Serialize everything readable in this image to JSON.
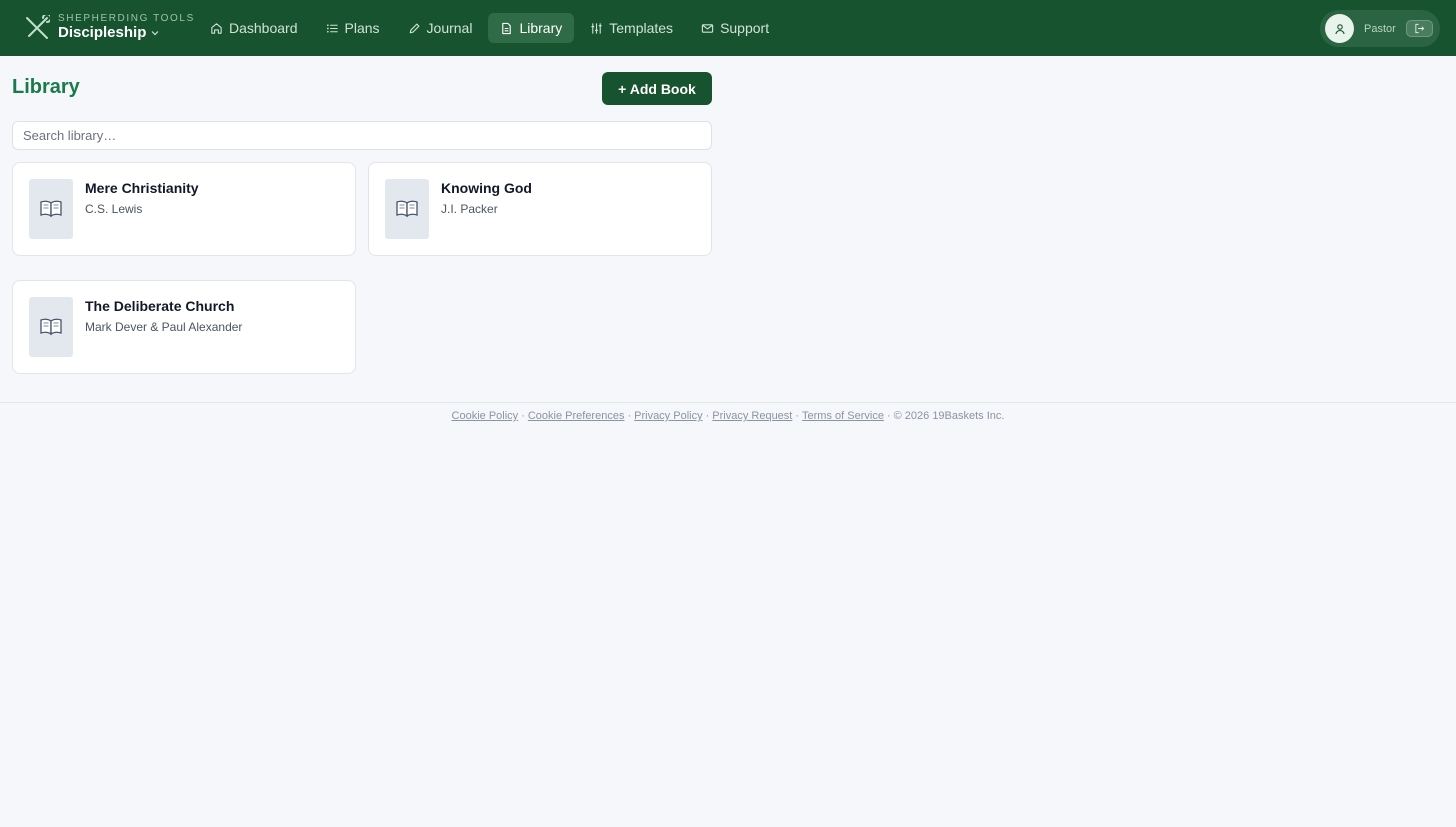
{
  "brand": {
    "kicker": "SHEPHERDING TOOLS",
    "name": "Discipleship",
    "logo_icon": "crossed-staffs-icon"
  },
  "nav": {
    "items": [
      {
        "label": "Dashboard",
        "icon": "home-icon",
        "active": false
      },
      {
        "label": "Plans",
        "icon": "list-icon",
        "active": false
      },
      {
        "label": "Journal",
        "icon": "pencil-icon",
        "active": false
      },
      {
        "label": "Library",
        "icon": "document-icon",
        "active": true
      },
      {
        "label": "Templates",
        "icon": "sliders-icon",
        "active": false
      },
      {
        "label": "Support",
        "icon": "mail-icon",
        "active": false
      }
    ]
  },
  "user": {
    "name": "Pastor",
    "avatar_icon": "user-icon",
    "logout_icon": "logout-icon"
  },
  "library": {
    "title": "Library",
    "add_label": "+ Add Book",
    "search_placeholder": "Search library…",
    "books": [
      {
        "title": "Mere Christianity",
        "author": "C.S. Lewis",
        "cover_icon": "open-book-icon"
      },
      {
        "title": "Knowing God",
        "author": "J.I. Packer",
        "cover_icon": "open-book-icon"
      },
      {
        "title": "The Deliberate Church",
        "author": "Mark Dever & Paul Alexander",
        "cover_icon": "open-book-icon"
      }
    ]
  },
  "footer": {
    "links": [
      "Cookie Policy",
      "Cookie Preferences",
      "Privacy Policy",
      "Privacy Request",
      "Terms of Service"
    ],
    "separator": "·",
    "copyright": "© 2026 19Baskets Inc."
  },
  "colors": {
    "topbar": "#18532f",
    "accent": "#1a7a4c",
    "active_nav": "#2f6b47",
    "background": "#f5f7fa"
  }
}
